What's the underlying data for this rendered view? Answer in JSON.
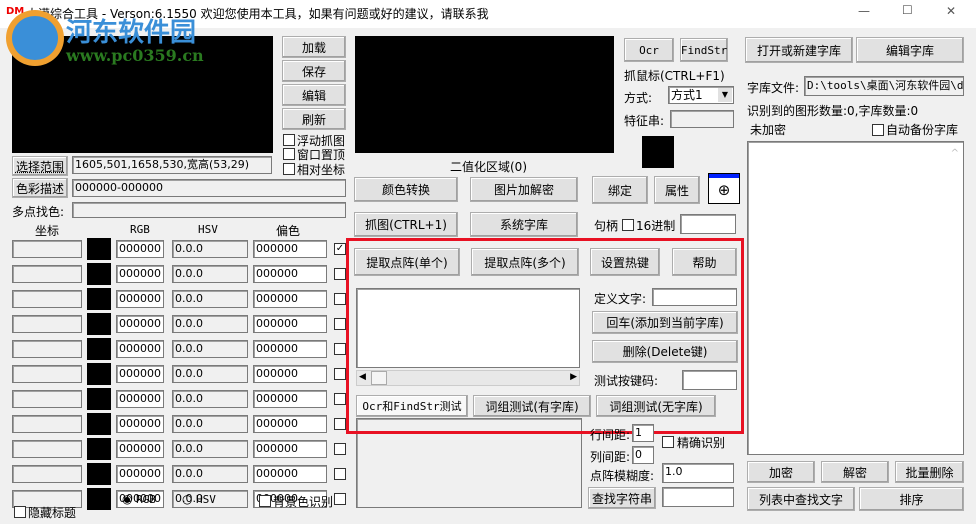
{
  "title": {
    "icon": "DM",
    "text": "大漠综合工具 -  Verson:6.1550  欢迎您使用本工具，如果有问题或好的建议，请联系我",
    "min": "—",
    "max": "☐",
    "close": "✕"
  },
  "watermark": {
    "name": "河东软件园",
    "url": "www.pc0359.cn"
  },
  "left": {
    "load": "加载",
    "save": "保存",
    "edit": "编辑",
    "refresh": "刷新",
    "float_capture": "浮动抓图",
    "topmost": "窗口置顶",
    "relative_coords": "相对坐标",
    "select_range": "选择范围",
    "range_value": "1605,501,1658,530,宽高(53,29)",
    "color_desc": "色彩描述",
    "color_desc_value": "000000-000000",
    "multi_point": "多点找色:",
    "multi_point_value": "",
    "headers": {
      "coord": "坐标",
      "rgb": "RGB",
      "hsv": "HSV",
      "offset": "偏色"
    },
    "rows": [
      {
        "coord": "",
        "rgb": "000000",
        "hsv": "0.0.0",
        "offset": "000000",
        "checked": true
      },
      {
        "coord": "",
        "rgb": "000000",
        "hsv": "0.0.0",
        "offset": "000000",
        "checked": false
      },
      {
        "coord": "",
        "rgb": "000000",
        "hsv": "0.0.0",
        "offset": "000000",
        "checked": false
      },
      {
        "coord": "",
        "rgb": "000000",
        "hsv": "0.0.0",
        "offset": "000000",
        "checked": false
      },
      {
        "coord": "",
        "rgb": "000000",
        "hsv": "0.0.0",
        "offset": "000000",
        "checked": false
      },
      {
        "coord": "",
        "rgb": "000000",
        "hsv": "0.0.0",
        "offset": "000000",
        "checked": false
      },
      {
        "coord": "",
        "rgb": "000000",
        "hsv": "0.0.0",
        "offset": "000000",
        "checked": false
      },
      {
        "coord": "",
        "rgb": "000000",
        "hsv": "0.0.0",
        "offset": "000000",
        "checked": false
      },
      {
        "coord": "",
        "rgb": "000000",
        "hsv": "0.0.0",
        "offset": "000000",
        "checked": false
      },
      {
        "coord": "",
        "rgb": "000000",
        "hsv": "0.0.0",
        "offset": "000000",
        "checked": false
      },
      {
        "coord": "",
        "rgb": "000000",
        "hsv": "0.0.0",
        "offset": "000000",
        "checked": false
      }
    ],
    "hide_title": "隐藏标题",
    "radio_rgb": "RGB",
    "radio_hsv": "HSV",
    "bg_color": "背景色识别"
  },
  "middle": {
    "binarize": "二值化区域(0)",
    "color_convert": "颜色转换",
    "image_crypt": "图片加解密",
    "capture": "抓图(CTRL+1)",
    "system_font": "系统字库",
    "extract_single": "提取点阵(单个)",
    "extract_multi": "提取点阵(多个)",
    "hotkey": "设置热键",
    "help": "帮助",
    "define_text": "定义文字:",
    "define_value": "",
    "enter_add": "回车(添加到当前字库)",
    "delete": "删除(Delete键)",
    "test_key": "测试按键码:",
    "test_key_value": "",
    "tab_ocr": "Ocr和FindStr测试",
    "tab_group_lib": "词组测试(有字库)",
    "tab_group_nolib": "词组测试(无字库)",
    "line_gap": "行间距:",
    "line_gap_value": "1",
    "col_gap": "列间距:",
    "col_gap_value": "0",
    "precise": "精确识别",
    "blur": "点阵模糊度:",
    "blur_value": "1.0",
    "find_str": "查找字符串",
    "find_str_value": ""
  },
  "tools": {
    "ocr": "Ocr",
    "findstr": "FindStr",
    "grab_mouse": "抓鼠标(CTRL+F1)",
    "mode": "方式:",
    "mode_value": "方式1",
    "feature": "特征串:",
    "feature_value": "",
    "bind": "绑定",
    "props": "属性",
    "handle": "句柄",
    "hex": "16进制",
    "handle_value": ""
  },
  "right": {
    "open_lib": "打开或新建字库",
    "edit_lib": "编辑字库",
    "lib_file": "字库文件:",
    "lib_file_value": "D:\\tools\\桌面\\河东软件园\\d",
    "recognized": "识别到的图形数量:0,字库数量:0",
    "unencrypted": "未加密",
    "auto_backup": "自动备份字库",
    "encrypt": "加密",
    "decrypt": "解密",
    "batch_delete": "批量删除",
    "find_in_list": "列表中查找文字",
    "sort": "排序"
  },
  "colors": {
    "highlight": "#e81123"
  }
}
